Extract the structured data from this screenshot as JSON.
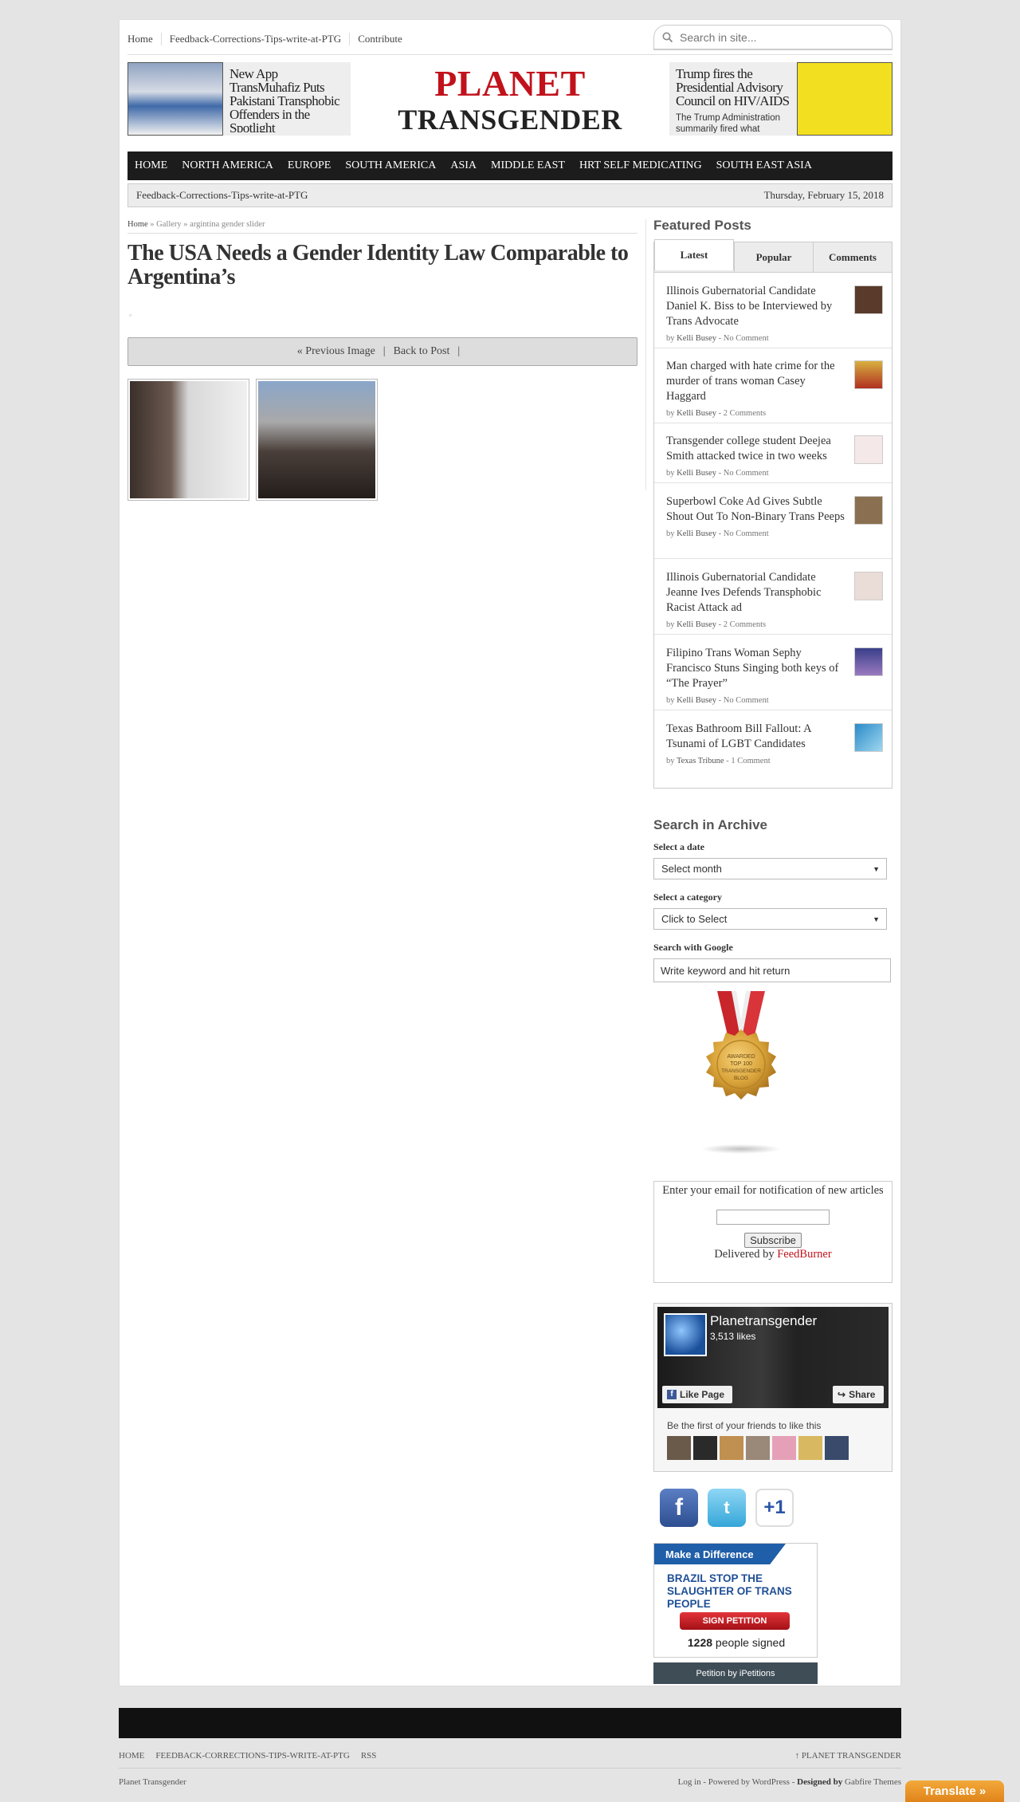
{
  "topnav": {
    "items": [
      "Home",
      "Feedback-Corrections-Tips-write-at-PTG",
      "Contribute"
    ],
    "search_placeholder": "Search in site..."
  },
  "header": {
    "logo_top": "PLANET",
    "logo_bottom": "TRANSGENDER",
    "promo_left": {
      "title": "New App TransMuhafiz Puts Pakistani Transphobic Offenders in the Spotlight"
    },
    "promo_right": {
      "title": "Trump fires the Presidential Advisory Council on HIV/AIDS",
      "excerpt": "The Trump Administration summarily fired what"
    }
  },
  "mainnav": [
    "HOME",
    "NORTH AMERICA",
    "EUROPE",
    "SOUTH AMERICA",
    "ASIA",
    "MIDDLE EAST",
    "HRT SELF MEDICATING",
    "SOUTH EAST ASIA"
  ],
  "subbar": {
    "link": "Feedback-Corrections-Tips-write-at-PTG",
    "date": "Thursday, February 15, 2018"
  },
  "breadcrumb": {
    "home": "Home",
    "sep": "»",
    "gallery": "Gallery",
    "current": "argintina gender slider"
  },
  "post": {
    "title": "The USA Needs a Gender Identity Law Comparable to Argentina’s",
    "nav": {
      "prev": "« Previous Image",
      "sep": "|",
      "back": "Back to Post"
    }
  },
  "sidebar": {
    "featured_heading": "Featured Posts",
    "tabs": [
      "Latest",
      "Popular",
      "Comments"
    ],
    "posts": [
      {
        "title": "Illinois Gubernatorial Candidate Daniel K. Biss to be Interviewed by Trans Advocate",
        "author": "Kelli Busey",
        "comments": "No Comment"
      },
      {
        "title": "Man charged with hate crime for the murder of trans woman Casey Haggard",
        "author": "Kelli Busey",
        "comments": "2 Comments"
      },
      {
        "title": "Transgender college student Deejea Smith attacked twice in two weeks",
        "author": "Kelli Busey",
        "comments": "No Comment"
      },
      {
        "title": "Superbowl Coke Ad Gives Subtle Shout Out To Non-Binary Trans Peeps",
        "author": "Kelli Busey",
        "comments": "No Comment"
      },
      {
        "title": "Illinois Gubernatorial Candidate Jeanne Ives Defends Transphobic Racist Attack ad",
        "author": "Kelli Busey",
        "comments": "2 Comments"
      },
      {
        "title": "Filipino Trans Woman Sephy Francisco Stuns Singing both keys of “The Prayer”",
        "author": "Kelli Busey",
        "comments": "No Comment"
      },
      {
        "title": "Texas Bathroom Bill Fallout: A Tsunami of LGBT Candidates",
        "author": "Texas Tribune",
        "comments": "1 Comment"
      }
    ],
    "by": "by",
    "dash": "-",
    "archive": {
      "heading": "Search in Archive",
      "date_label": "Select a date",
      "date_value": "Select month",
      "category_label": "Select a category",
      "category_value": "Click to Select",
      "google_label": "Search with Google",
      "google_value": "Write keyword and hit return"
    },
    "medal": {
      "line1": "AWARDED",
      "line2": "TOP 100",
      "line3": "TRANSGENDER",
      "line4": "BLOG"
    },
    "feedburner": {
      "prompt": "Enter your email for notification of new articles",
      "button": "Subscribe",
      "delivered": "Delivered by",
      "provider": "FeedBurner"
    },
    "facebook": {
      "name": "Planetransgender",
      "likes": "3,513 likes",
      "like_btn": "Like Page",
      "share_btn": "Share",
      "friends": "Be the first of your friends to like this"
    },
    "social": {
      "facebook": "f",
      "twitter": "t",
      "gplus": "+1"
    },
    "petition": {
      "banner": "Make a Difference",
      "title": "BRAZIL STOP THE SLAUGHTER OF TRANS PEOPLE",
      "button": "SIGN PETITION",
      "count": "1228",
      "count_suffix": "people signed",
      "footer": "Petition by iPetitions"
    }
  },
  "footer": {
    "nav": [
      "HOME",
      "FEEDBACK-CORRECTIONS-TIPS-WRITE-AT-PTG",
      "RSS"
    ],
    "top_link": "↑ PLANET TRANSGENDER",
    "site": "Planet Transgender",
    "credits_pre": "Log in - Powered by WordPress -",
    "credits_designed": "Designed by",
    "credits_author": "Gabfire Themes",
    "translate": "Translate »"
  },
  "colors": {
    "brand_red": "#c1121c",
    "nav_dark": "#1c1c1c",
    "translate_orange": "#e0841a"
  }
}
